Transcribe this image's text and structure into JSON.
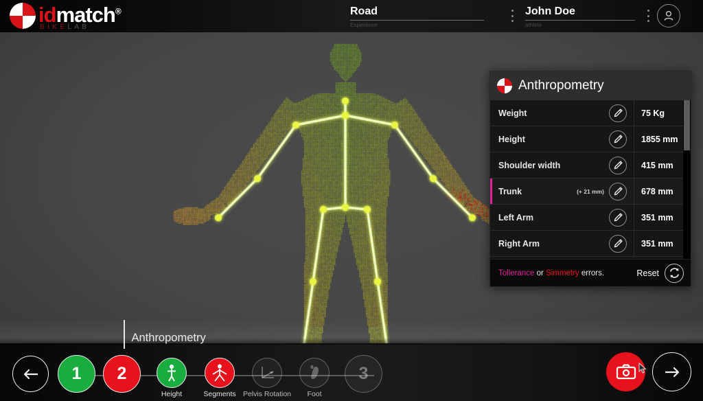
{
  "brand": {
    "name_id": "id",
    "name_match": "match",
    "registered": "®",
    "sub_bike": "BIKE",
    "sub_lab": "LAB"
  },
  "header": {
    "experience": {
      "value": "Road",
      "label": "Experience"
    },
    "athlete": {
      "value": "John Doe",
      "label": "athlete"
    },
    "kebab_icon": "more-vertical-icon",
    "avatar_icon": "user-avatar-icon"
  },
  "panel": {
    "title": "Anthropometry",
    "logo_icon": "idmatch-mark-icon",
    "edit_icon": "pencil-icon",
    "rows": [
      {
        "label": "Weight",
        "delta": "",
        "value": "75 Kg",
        "alert": false
      },
      {
        "label": "Height",
        "delta": "",
        "value": "1855 mm",
        "alert": false
      },
      {
        "label": "Shoulder width",
        "delta": "",
        "value": "415 mm",
        "alert": false
      },
      {
        "label": "Trunk",
        "delta": "(+ 21 mm)",
        "value": "678 mm",
        "alert": true
      },
      {
        "label": "Left Arm",
        "delta": "",
        "value": "351 mm",
        "alert": false
      },
      {
        "label": "Right Arm",
        "delta": "",
        "value": "351 mm",
        "alert": false
      }
    ],
    "footer": {
      "tolerance_word": "Tollerance",
      "or_word": "or",
      "simmetry_word": "Simmetry",
      "errors_word": "errors.",
      "reset_label": "Reset",
      "reset_icon": "refresh-icon"
    },
    "scrollbar_icon": "vertical-scrollbar"
  },
  "bottom": {
    "tooltip": "Anthropometry",
    "back_icon": "arrow-left-icon",
    "next_icon": "arrow-right-icon",
    "capture_icon": "camera-icon",
    "cursor_icon": "mouse-cursor-icon",
    "steps": [
      {
        "id": "1",
        "label": "1",
        "state": "done"
      },
      {
        "id": "2",
        "label": "2",
        "state": "active"
      },
      {
        "id": "3",
        "label": "3",
        "state": "disabled"
      }
    ],
    "substeps": [
      {
        "label": "Height",
        "icon": "standing-person-icon",
        "state": "done"
      },
      {
        "label": "Segments",
        "icon": "spread-person-icon",
        "state": "active"
      },
      {
        "label": "Pelvis Rotation",
        "icon": "angle-icon",
        "state": "disabled"
      },
      {
        "label": "Foot",
        "icon": "footprint-icon",
        "state": "disabled"
      }
    ]
  },
  "viewport": {
    "scan_icon": "body-point-cloud",
    "skeleton_icon": "skeleton-overlay"
  },
  "colors": {
    "brand_red": "#d9131a",
    "step_green": "#19ac3f",
    "step_red": "#e8121c",
    "tolerance_magenta": "#e0219c",
    "simmetry_red": "#e8161f",
    "scan_green": "#9ccc22",
    "joint_yellow": "#e9f542"
  }
}
